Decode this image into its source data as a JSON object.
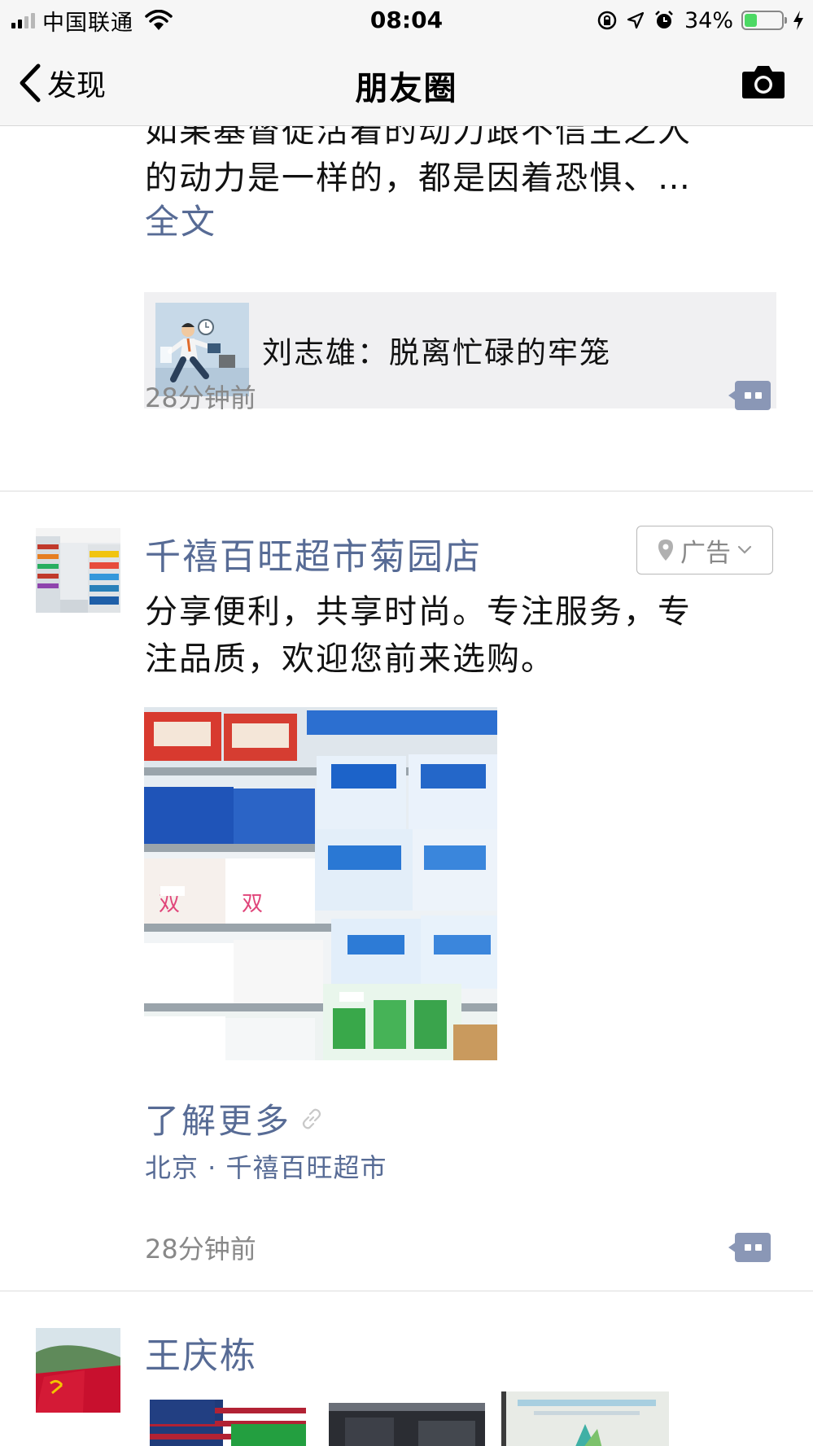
{
  "status_bar": {
    "carrier": "中国联通",
    "time": "08:04",
    "battery_percent": "34%",
    "battery_level": 0.34,
    "battery_color": "#4cd964"
  },
  "nav": {
    "back_label": "发现",
    "title": "朋友圈",
    "camera_icon": "camera-icon"
  },
  "posts": [
    {
      "text_lines": [
        "如果基督徒活着的动力跟不信主之人",
        "的动力是一样的，都是因着恐惧、…"
      ],
      "expand_label": "全文",
      "share": {
        "title": "刘志雄：脱离忙碌的牢笼",
        "thumb_icon": "businessman-running-illustration"
      },
      "time": "28分钟前"
    },
    {
      "author": "千禧百旺超市菊园店",
      "ad_label": "广告",
      "text_lines": [
        "分享便利，共享时尚。专注服务，专",
        "注品质，欢迎您前来选购。"
      ],
      "image_icon": "supermarket-sugar-shelf-photo",
      "learn_more": "了解更多",
      "location": "北京 · 千禧百旺超市",
      "time": "28分钟前"
    },
    {
      "author": "王庆栋"
    }
  ],
  "colors": {
    "link": "#576b95",
    "meta": "#888888",
    "bar_bg": "#f6f6f6"
  }
}
